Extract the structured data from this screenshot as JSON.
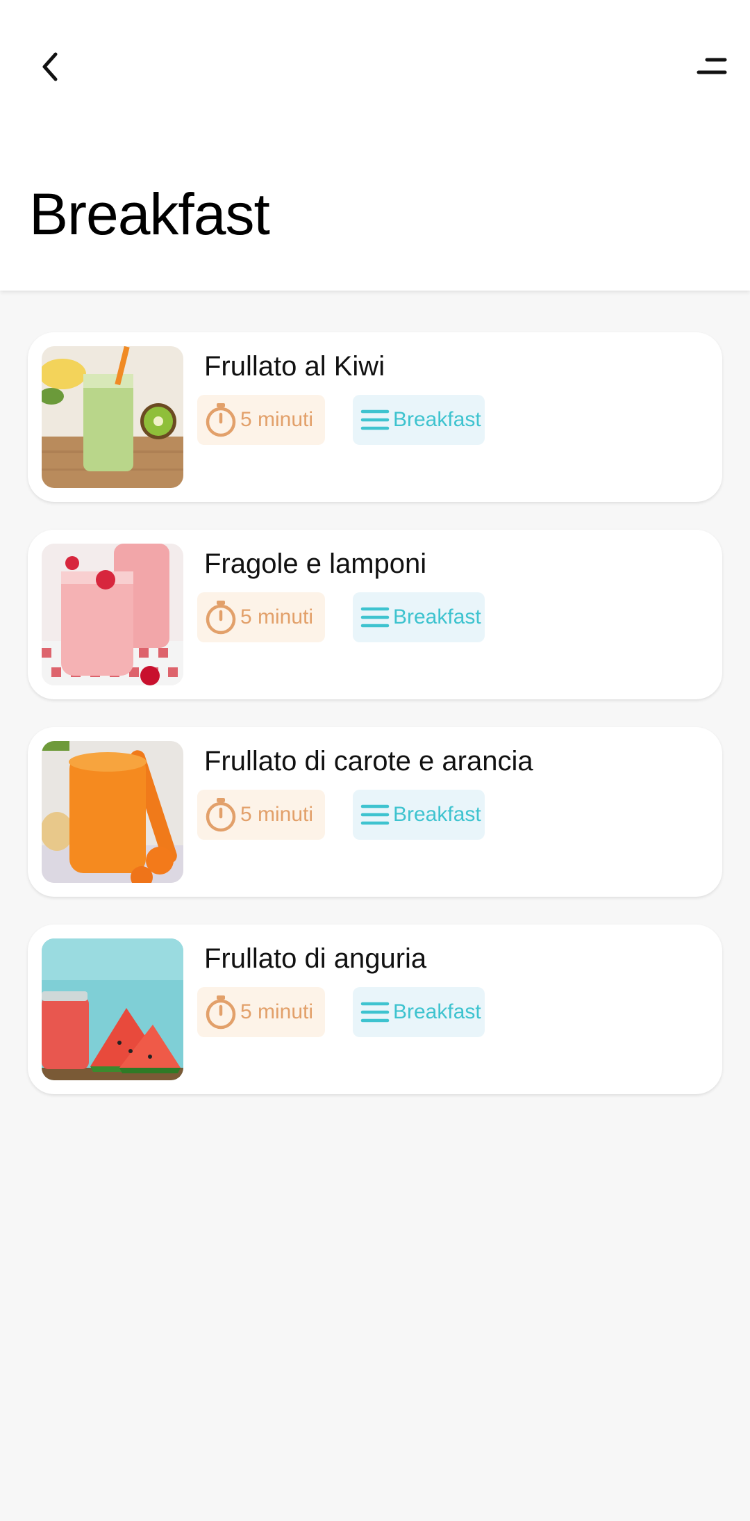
{
  "header": {
    "title": "Breakfast",
    "back_icon": "chevron-left-icon",
    "menu_icon": "menu-icon"
  },
  "colors": {
    "time_badge_bg": "#fdf3e8",
    "time_badge_text": "#e2a06a",
    "category_badge_bg": "#e9f5fa",
    "category_badge_text": "#3ec3cf"
  },
  "recipes": [
    {
      "title": "Frullato al Kiwi",
      "time": "5 minuti",
      "category": "Breakfast",
      "image": "kiwi-smoothie"
    },
    {
      "title": "Fragole e lamponi",
      "time": "5 minuti",
      "category": "Breakfast",
      "image": "strawberry-raspberry-smoothie"
    },
    {
      "title": "Frullato di carote e arancia",
      "time": "5 minuti",
      "category": "Breakfast",
      "image": "carrot-orange-smoothie"
    },
    {
      "title": "Frullato di anguria",
      "time": "5 minuti",
      "category": "Breakfast",
      "image": "watermelon-smoothie"
    }
  ]
}
